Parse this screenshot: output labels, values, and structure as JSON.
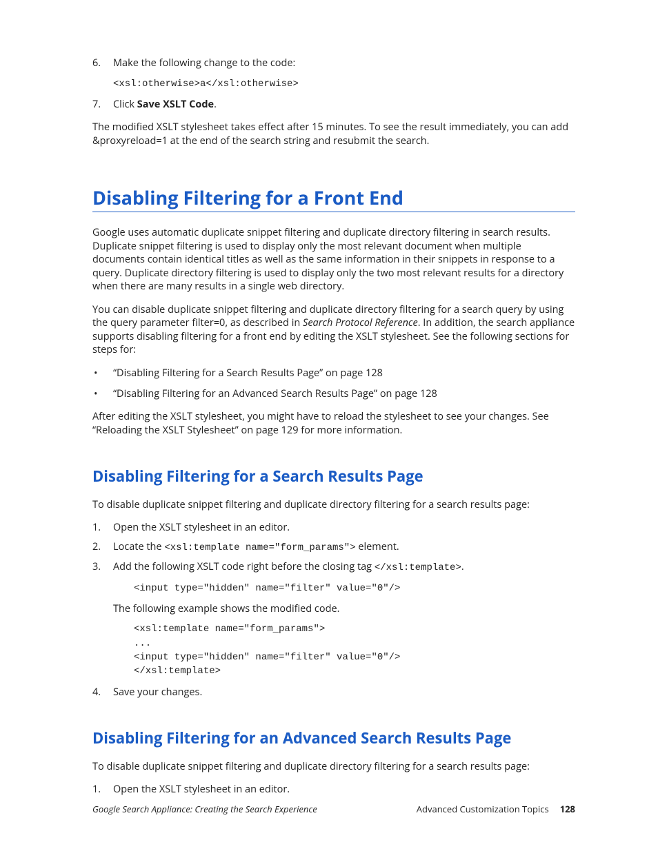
{
  "steps_top": [
    {
      "num": "6.",
      "text": "Make the following change to the code:"
    },
    {
      "num": "7.",
      "prefix": "Click ",
      "bold": "Save XSLT Code",
      "suffix": "."
    }
  ],
  "code1": "<xsl:otherwise>a</xsl:otherwise>",
  "para_intro": "The modified XSLT stylesheet takes effect after 15 minutes. To see the result immediately, you can add &proxyreload=1 at the end of the search string and resubmit the search.",
  "h1": "Disabling Filtering for a Front End",
  "para_h1_a": "Google uses automatic duplicate snippet filtering and duplicate directory filtering in search results. Duplicate snippet filtering is used to display only the most relevant document when multiple documents contain identical titles as well as the same information in their snippets in response to a query. Duplicate directory filtering is used to display only the two most relevant results for a directory when there are many results in a single web directory.",
  "para_h1_b_pre": "You can disable duplicate snippet filtering and duplicate directory filtering for a search query by using the query parameter filter=0, as described in ",
  "para_h1_b_em": "Search Protocol Reference",
  "para_h1_b_post": ". In addition, the search appliance supports disabling filtering for a front end by editing the XSLT stylesheet. See the following sections for steps for:",
  "bullets": [
    "“Disabling Filtering for a Search Results Page” on page 128",
    "“Disabling Filtering for an Advanced Search Results Page” on page 128"
  ],
  "para_h1_c": "After editing the XSLT stylesheet, you might have to reload the stylesheet to see your changes. See “Reloading the XSLT Stylesheet” on page 129 for more information.",
  "h2a": "Disabling Filtering for a Search Results Page",
  "para_h2a_intro": "To disable duplicate snippet filtering and duplicate directory filtering for a search results page:",
  "h2a_steps": {
    "s1": {
      "num": "1.",
      "text": "Open the XSLT stylesheet in an editor."
    },
    "s2": {
      "num": "2.",
      "pre": "Locate the ",
      "code": "<xsl:template name=\"form_params\">",
      "post": " element."
    },
    "s3": {
      "num": "3.",
      "pre": "Add the following XSLT code right before the closing tag ",
      "code": "</xsl:template>",
      "post": "."
    },
    "s4": {
      "num": "4.",
      "text": "Save your changes."
    }
  },
  "h2a_code1": "<input type=\"hidden\" name=\"filter\" value=\"0\"/>",
  "h2a_sub": "The following example shows the modified code.",
  "h2a_code2": "<xsl:template name=\"form_params\">\n...\n<input type=\"hidden\" name=\"filter\" value=\"0\"/>\n</xsl:template>",
  "h2b": "Disabling Filtering for an Advanced Search Results Page",
  "para_h2b_intro": "To disable duplicate snippet filtering and duplicate directory filtering for a search results page:",
  "h2b_steps": {
    "s1": {
      "num": "1.",
      "text": "Open the XSLT stylesheet in an editor."
    }
  },
  "footer": {
    "left": "Google Search Appliance: Creating the Search Experience",
    "right": "Advanced Customization Topics",
    "page": "128"
  }
}
